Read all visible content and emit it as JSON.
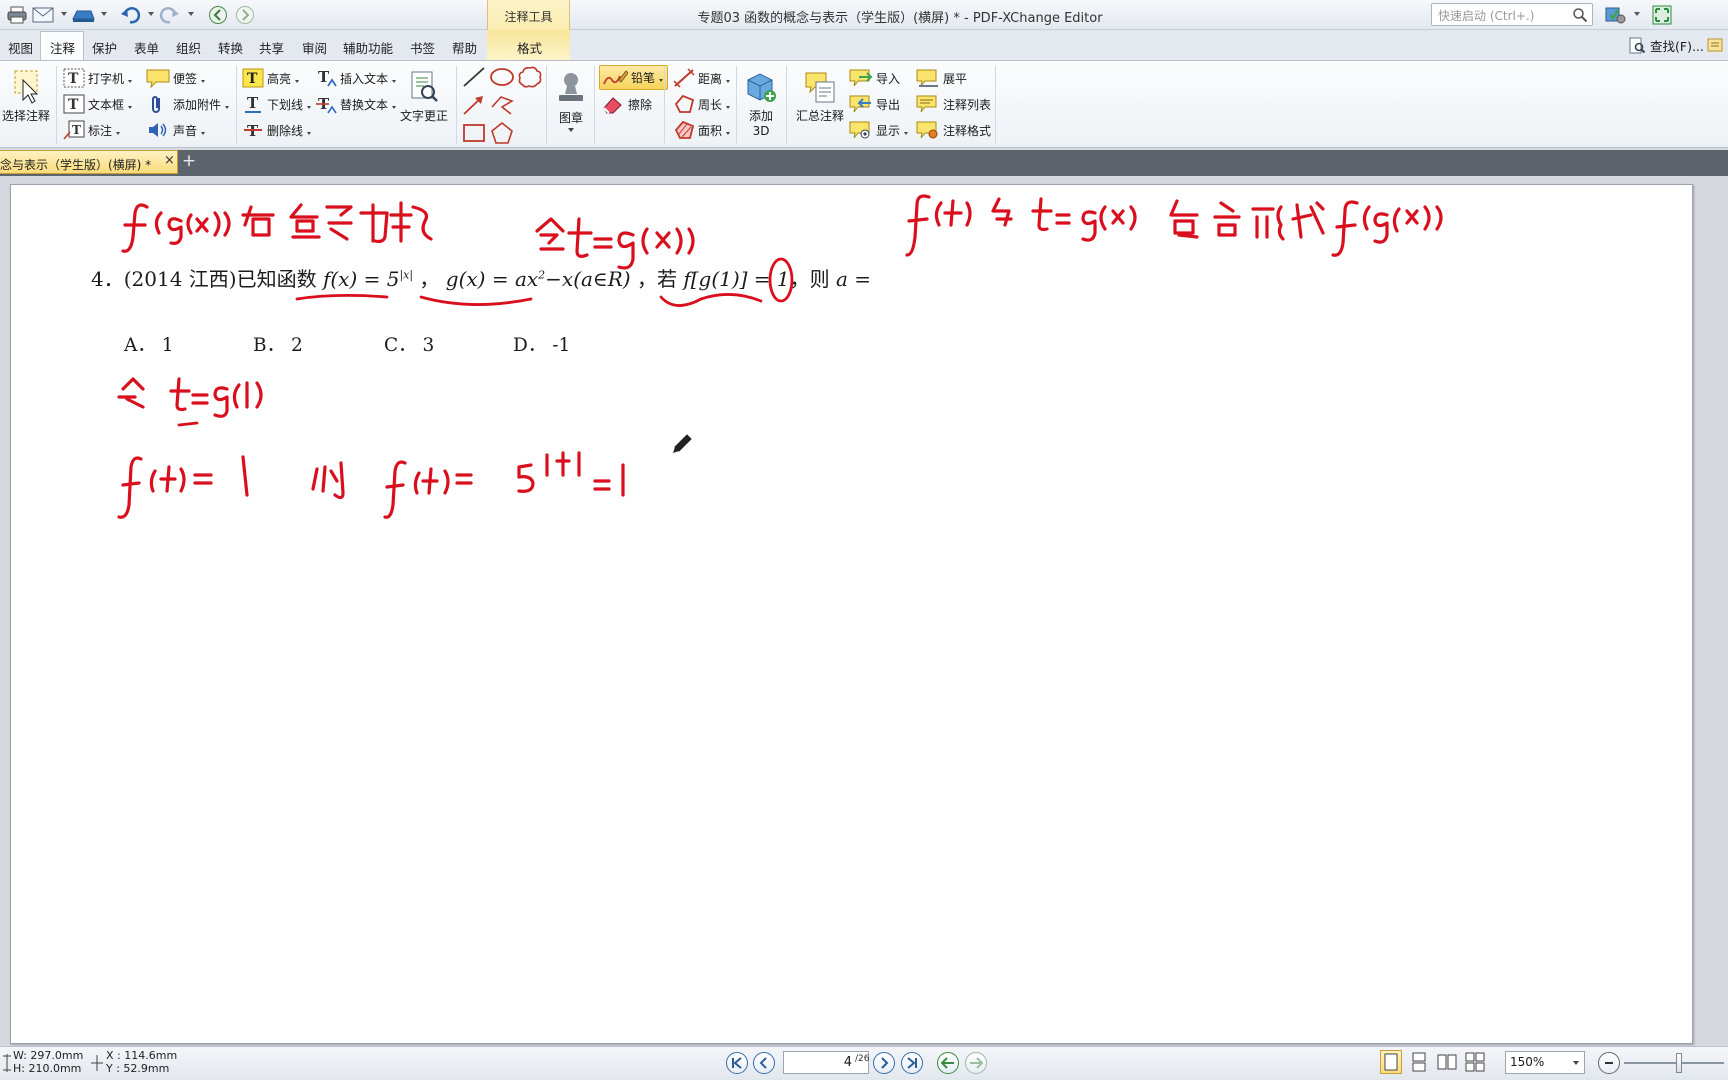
{
  "window": {
    "title": "专题03 函数的概念与表示（学生版）(横屏) * - PDF-XChange Editor",
    "context_tool_label": "注释工具",
    "quick_launch_placeholder": "快速启动 (Ctrl+.)"
  },
  "tabs": [
    "视图",
    "注释",
    "保护",
    "表单",
    "组织",
    "转换",
    "共享",
    "审阅",
    "辅助功能",
    "书签",
    "帮助",
    "格式"
  ],
  "active_tab": "注释",
  "find_label": "查找(F)...",
  "ribbon": {
    "select_annotation": "选择注释",
    "typewriter": "打字机",
    "textbox": "文本框",
    "callout": "标注",
    "sticky_note": "便签",
    "attach_file": "添加附件",
    "sound": "声音",
    "highlight": "高亮",
    "underline": "下划线",
    "strikeout": "删除线",
    "insert_text": "插入文本",
    "replace_text": "替换文本",
    "text_correction": "文字更正",
    "stamp": "图章",
    "pencil": "铅笔",
    "eraser": "擦除",
    "distance": "距离",
    "perimeter": "周长",
    "area": "面积",
    "add_3d_line1": "添加",
    "add_3d_line2": "3D",
    "summarize": "汇总注释",
    "import": "导入",
    "export": "导出",
    "show": "显示",
    "flatten": "展平",
    "comments_list": "注释列表",
    "comment_styles": "注释格式"
  },
  "document_tab": {
    "label": "念与表示（学生版）(横屏)  *",
    "close": "×",
    "new": "+"
  },
  "problem": {
    "number_source": "4．(2014 江西)已知函数",
    "f_def": "f(x) = 5",
    "f_exp": "|x|",
    "sep1": "，",
    "g_def": "g(x) = ax",
    "g_sq": "2",
    "g_rest": "−x(a∈R)",
    "cond_pre": "，若",
    "cond": "f[g(1)] = 1",
    "ask": "，则",
    "ask_var": "a =",
    "choices": [
      {
        "label": "A．",
        "value": "1"
      },
      {
        "label": "B．",
        "value": "2"
      },
      {
        "label": "C．",
        "value": "3"
      },
      {
        "label": "D．",
        "value": "-1"
      }
    ]
  },
  "ink_color": "#d90f1e",
  "status": {
    "w": "W: 297.0mm",
    "h": "H: 210.0mm",
    "x": "X : 114.6mm",
    "y": "Y :   52.9mm",
    "current_page": "4",
    "total_pages": "/26",
    "zoom": "150%"
  }
}
